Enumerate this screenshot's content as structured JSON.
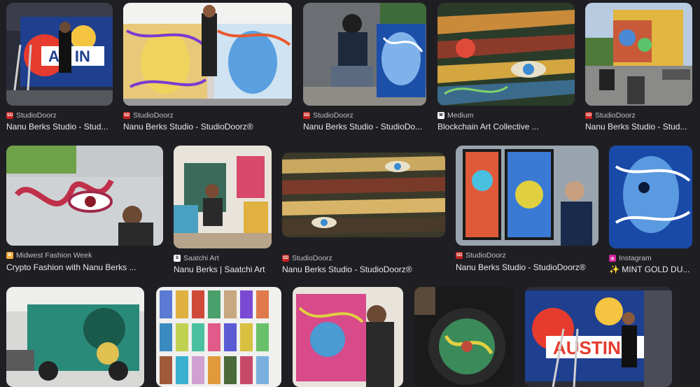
{
  "results": [
    {
      "source": "StudioDoorz",
      "favicon": "studiodoorz-icon",
      "title": "Nanu Berks Studio - Stud..."
    },
    {
      "source": "StudioDoorz",
      "favicon": "studiodoorz-icon",
      "title": "Nanu Berks Studio - StudioDoorz®"
    },
    {
      "source": "StudioDoorz",
      "favicon": "studiodoorz-icon",
      "title": "Nanu Berks Studio - StudioDo..."
    },
    {
      "source": "Medium",
      "favicon": "medium-icon",
      "title": "Blockchain Art Collective ..."
    },
    {
      "source": "StudioDoorz",
      "favicon": "studiodoorz-icon",
      "title": "Nanu Berks Studio - Stud..."
    },
    {
      "source": "Midwest Fashion Week",
      "favicon": "midwest-fashion-week-icon",
      "title": "Crypto Fashion with Nanu Berks ..."
    },
    {
      "source": "Saatchi Art",
      "favicon": "saatchi-art-icon",
      "title": "Nanu Berks | Saatchi Art"
    },
    {
      "source": "StudioDoorz",
      "favicon": "studiodoorz-icon",
      "title": "Nanu Berks Studio - StudioDoorz®"
    },
    {
      "source": "StudioDoorz",
      "favicon": "studiodoorz-icon",
      "title": "Nanu Berks Studio - StudioDoorz®"
    },
    {
      "source": "Instagram",
      "favicon": "instagram-icon",
      "title": "✨ MINT GOLD DU..."
    }
  ],
  "colors": {
    "background": "#1f1f23",
    "studiodoorz": "#c5221f",
    "instagram": "#d6249f"
  }
}
